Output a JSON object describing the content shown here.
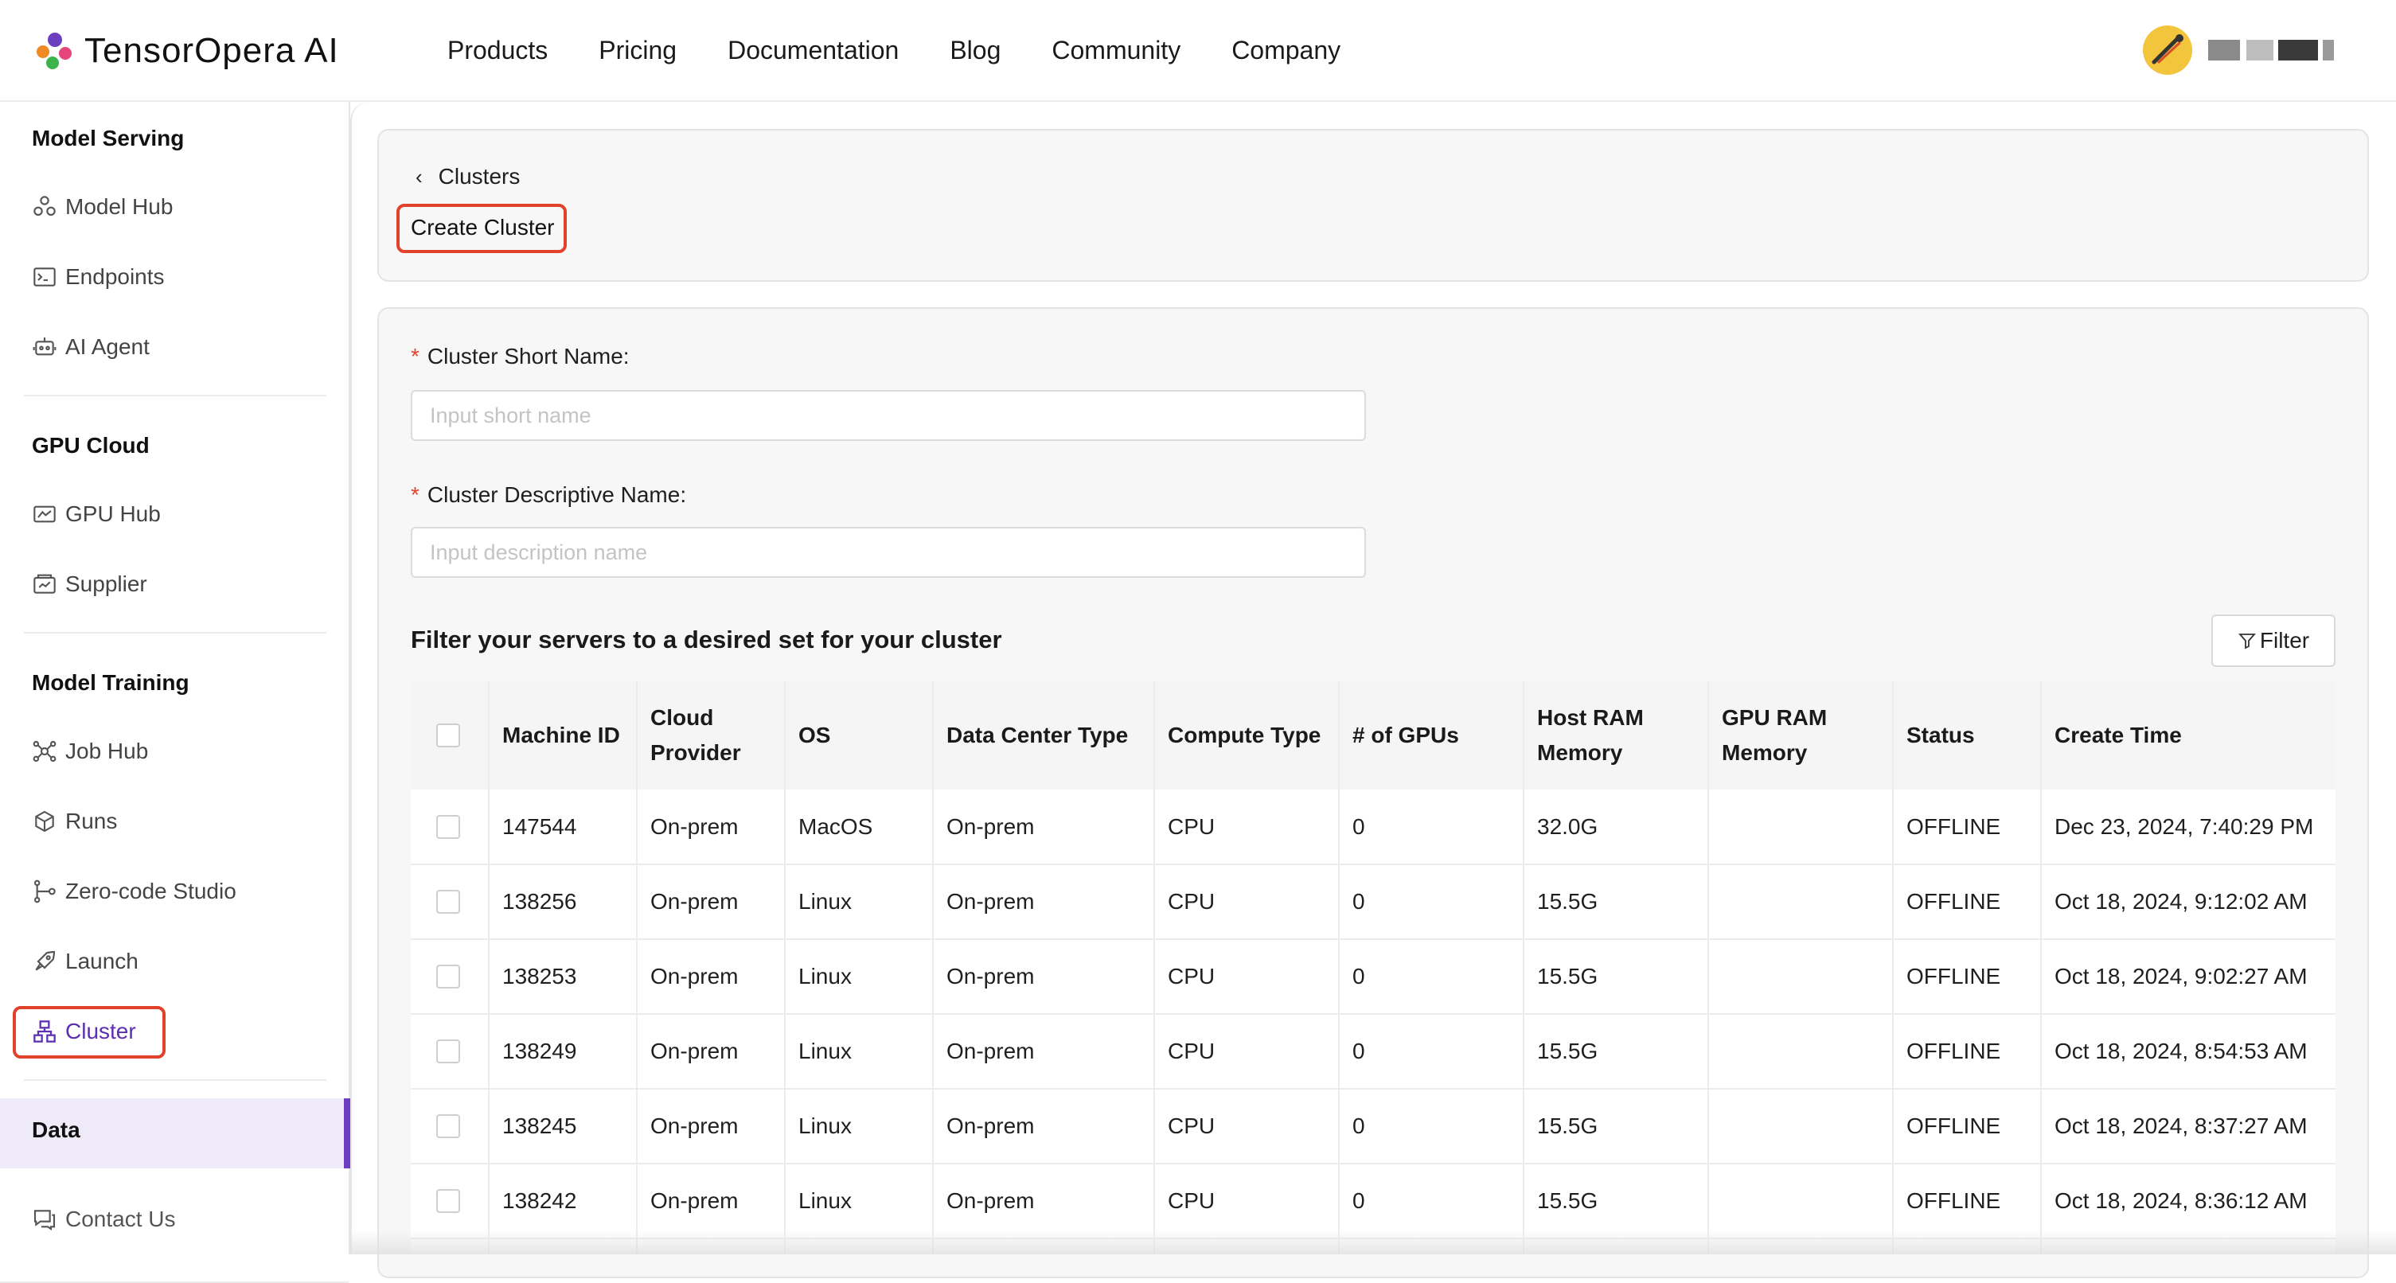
{
  "app": {
    "logo_text": "TensorOpera AI",
    "colors": {
      "accent": "#6b3fbf",
      "highlight": "#e0422b",
      "required": "#e0422b"
    }
  },
  "nav": {
    "items": [
      {
        "label": "Products"
      },
      {
        "label": "Pricing"
      },
      {
        "label": "Documentation"
      },
      {
        "label": "Blog"
      },
      {
        "label": "Community"
      },
      {
        "label": "Company"
      }
    ]
  },
  "user": {
    "avatar_icon": "avatar-icon",
    "name_label": "redacted"
  },
  "sidebar": {
    "sections": [
      {
        "title": "Model Serving"
      },
      {
        "title": "GPU Cloud"
      },
      {
        "title": "Model Training"
      },
      {
        "title": "Data"
      }
    ],
    "items": [
      {
        "label": "Model Hub",
        "icon": "model-hub-icon"
      },
      {
        "label": "Endpoints",
        "icon": "terminal-icon"
      },
      {
        "label": "AI Agent",
        "icon": "robot-icon"
      },
      {
        "label": "GPU Hub",
        "icon": "gpu-icon"
      },
      {
        "label": "Supplier",
        "icon": "supplier-icon"
      },
      {
        "label": "Job Hub",
        "icon": "network-icon"
      },
      {
        "label": "Runs",
        "icon": "cube-icon"
      },
      {
        "label": "Zero-code Studio",
        "icon": "flow-icon"
      },
      {
        "label": "Launch",
        "icon": "rocket-icon"
      },
      {
        "label": "Cluster",
        "icon": "cluster-icon",
        "active": true
      }
    ],
    "footer": {
      "label": "Contact Us",
      "icon": "chat-icon"
    }
  },
  "header": {
    "breadcrumb": "Clusters",
    "title": "Create Cluster"
  },
  "form": {
    "short_name_label": "Cluster Short Name:",
    "short_name_placeholder": "Input short name",
    "short_name_value": "",
    "descriptive_name_label": "Cluster Descriptive Name:",
    "descriptive_name_placeholder": "Input description name",
    "descriptive_name_value": "",
    "required_mark": "*"
  },
  "filter": {
    "title": "Filter your servers to a desired set for your cluster",
    "button_label": "Filter"
  },
  "table": {
    "columns": [
      "Machine ID",
      "Cloud Provider",
      "OS",
      "Data Center Type",
      "Compute Type",
      "# of GPUs",
      "Host RAM Memory",
      "GPU RAM Memory",
      "Status",
      "Create Time"
    ],
    "rows": [
      [
        "147544",
        "On-prem",
        "MacOS",
        "On-prem",
        "CPU",
        "0",
        "32.0G",
        "",
        "OFFLINE",
        "Dec 23, 2024, 7:40:29 PM"
      ],
      [
        "138256",
        "On-prem",
        "Linux",
        "On-prem",
        "CPU",
        "0",
        "15.5G",
        "",
        "OFFLINE",
        "Oct 18, 2024, 9:12:02 AM"
      ],
      [
        "138253",
        "On-prem",
        "Linux",
        "On-prem",
        "CPU",
        "0",
        "15.5G",
        "",
        "OFFLINE",
        "Oct 18, 2024, 9:02:27 AM"
      ],
      [
        "138249",
        "On-prem",
        "Linux",
        "On-prem",
        "CPU",
        "0",
        "15.5G",
        "",
        "OFFLINE",
        "Oct 18, 2024, 8:54:53 AM"
      ],
      [
        "138245",
        "On-prem",
        "Linux",
        "On-prem",
        "CPU",
        "0",
        "15.5G",
        "",
        "OFFLINE",
        "Oct 18, 2024, 8:37:27 AM"
      ],
      [
        "138242",
        "On-prem",
        "Linux",
        "On-prem",
        "CPU",
        "0",
        "15.5G",
        "",
        "OFFLINE",
        "Oct 18, 2024, 8:36:12 AM"
      ],
      [
        "",
        "",
        "",
        "",
        "",
        "",
        "",
        "",
        "",
        ""
      ]
    ]
  }
}
